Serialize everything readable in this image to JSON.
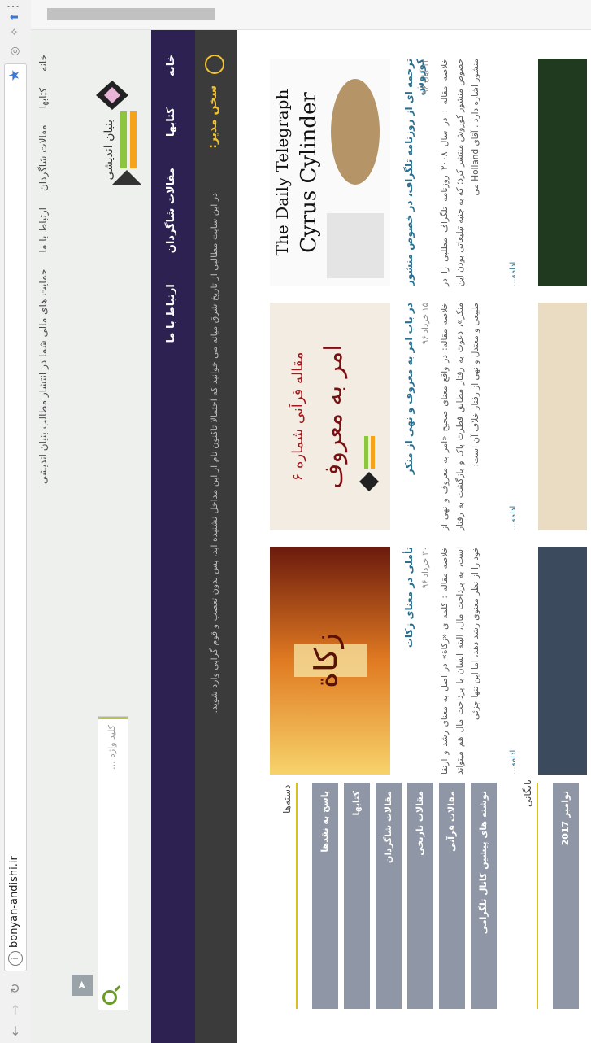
{
  "browser": {
    "url": "bonyan-andishi.ir",
    "back_icon": "arrow-back",
    "forward_icon": "arrow-forward",
    "reload_icon": "reload"
  },
  "header": {
    "top_nav": [
      "خانه",
      "کتابها",
      "مقالات شاگردان",
      "ارتباط با ما",
      "حمایت های مالی شما در انتشار مطالب بنیان اندیشی"
    ],
    "logo_text": "بنیان اندیشی",
    "search_placeholder": "کلید واژه ..."
  },
  "main_nav": [
    "خانه",
    "کتابها",
    "مقالات شاگردان",
    "ارتباط با ما"
  ],
  "ticker": {
    "label": "سخن مدیر:",
    "text": "در این سایت مطالبی از تاریخ شرق میانه می خوانید که احتمالا تاکنون نام از این مداخل نشنیده اید، پس بدون تعصب و قوم گرایی وارد شوید."
  },
  "sidebar": {
    "categories_title": "دسته‌ها",
    "categories": [
      "پاسخ به نقدها",
      "کتابها",
      "مقالات شاگردان",
      "مقالات تاریخی",
      "مقالات قرآنی",
      "نوشته های پیشین کانال تلگرامی"
    ],
    "archive_title": "بایگانی",
    "archive": [
      "نوامبر 2017"
    ]
  },
  "posts": [
    {
      "title": "ترجمه ای از روزنامه تلگراف، در خصوص منشور کوروش",
      "date": "۱۲ آبان ۹۶",
      "excerpt": "خلاصه مقاله : در سال ۲۰۰۸ روزنامه تلگراف مطلبی را در خصوص منشور کوروش منتشر کرد؛ که به جنبه تبلیغاتی بودن این منشور اشاره دارد . آقای Holland می",
      "more": "ادامه...",
      "image_text": "The Daily Telegraph — Cyrus Cylinder"
    },
    {
      "title": "در باب امر به معروف و نهی از منکر",
      "date": "۱۵ خرداد ۹۶",
      "excerpt": "خلاصه مقاله: در واقع معنای صحیح «امر به معروف و نهی از منکر»، دعوت به رفتار مطابق فطرت پاک و بازگشت به رفتار طبیعی و معتدل و نهی از رفتار خلاف آن است؛",
      "more": "ادامه...",
      "image_text": "مقاله قرآنی شماره ۶ — امر به معروف و نهی از منکر"
    },
    {
      "title": "تأملی در معنای زکات",
      "date": "۳۰ خرداد ۹۶",
      "excerpt": "خلاصه مقاله : کلمه ی «زکاة» در اصل به معنای رشد و ارتقا است، به پرداخت مال، البته انسان با پرداخت مال هم میتواند خود را از نظر معنوی رشد دهد، اما این تنها جزئی",
      "more": "ادامه...",
      "image_text": "تأملی در معنای زکات"
    }
  ],
  "colors": {
    "nav_bg": "#2c2150",
    "ticker_bg": "#3b3b3b",
    "accent_yellow": "#f1c232",
    "link_blue": "#2a6f8f",
    "category_gray": "#8f96a5"
  }
}
